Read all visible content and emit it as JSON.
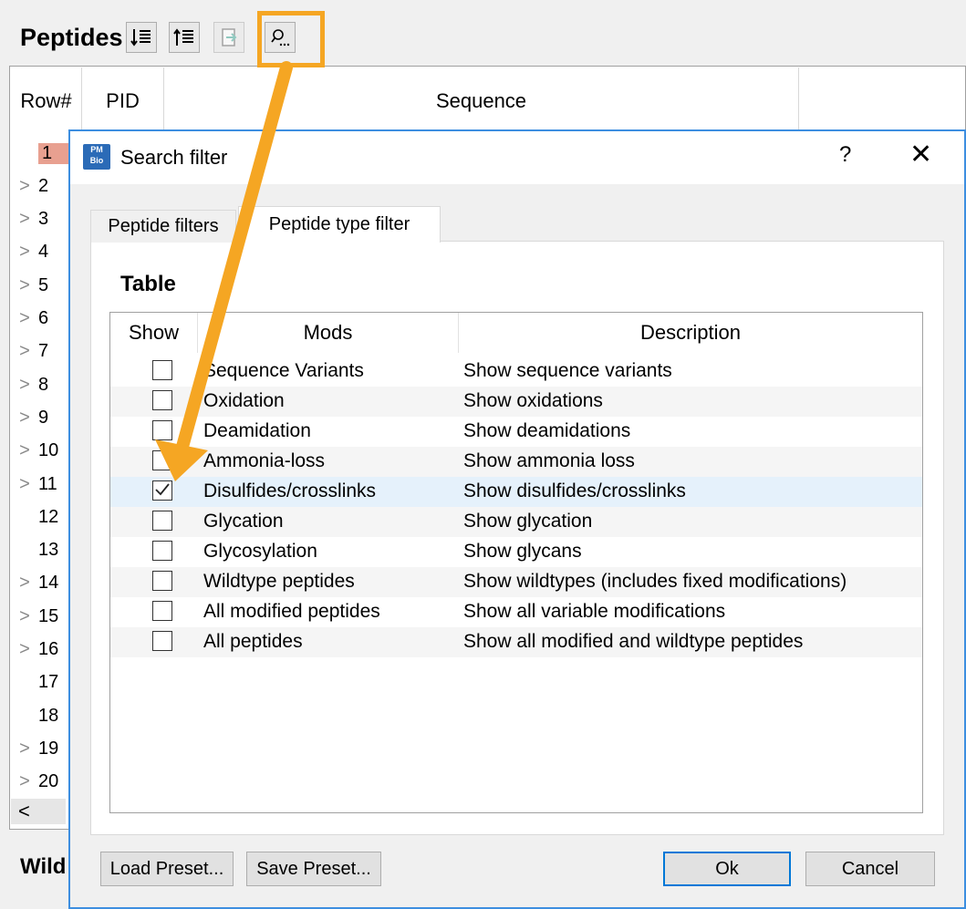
{
  "background": {
    "panel_title": "Peptides",
    "toolbar_icons": [
      "sort-descending-icon",
      "sort-ascending-icon",
      "export-icon",
      "search-filter-icon"
    ],
    "columns": [
      "Row#",
      "PID",
      "Sequence"
    ],
    "rows": [
      {
        "num": "1",
        "expandable": false,
        "highlight": true
      },
      {
        "num": "2",
        "expandable": true
      },
      {
        "num": "3",
        "expandable": true
      },
      {
        "num": "4",
        "expandable": true
      },
      {
        "num": "5",
        "expandable": true
      },
      {
        "num": "6",
        "expandable": true
      },
      {
        "num": "7",
        "expandable": true
      },
      {
        "num": "8",
        "expandable": true
      },
      {
        "num": "9",
        "expandable": true
      },
      {
        "num": "10",
        "expandable": true
      },
      {
        "num": "11",
        "expandable": true
      },
      {
        "num": "12",
        "expandable": false
      },
      {
        "num": "13",
        "expandable": false
      },
      {
        "num": "14",
        "expandable": true
      },
      {
        "num": "15",
        "expandable": true
      },
      {
        "num": "16",
        "expandable": true
      },
      {
        "num": "17",
        "expandable": false
      },
      {
        "num": "18",
        "expandable": false
      },
      {
        "num": "19",
        "expandable": true
      },
      {
        "num": "20",
        "expandable": true
      }
    ],
    "scroll_left": "<",
    "lower_panel_title": "Wild"
  },
  "dialog": {
    "title": "Search filter",
    "help": "?",
    "close": "✕",
    "tabs": [
      {
        "label": "Peptide filters",
        "active": false
      },
      {
        "label": "Peptide type filter",
        "active": true
      }
    ],
    "section_title": "Table",
    "table": {
      "headers": [
        "Show",
        "Mods",
        "Description"
      ],
      "rows": [
        {
          "checked": false,
          "mod": "Sequence Variants",
          "desc": "Show sequence variants"
        },
        {
          "checked": false,
          "mod": "Oxidation",
          "desc": "Show oxidations"
        },
        {
          "checked": false,
          "mod": "Deamidation",
          "desc": "Show deamidations"
        },
        {
          "checked": false,
          "mod": "Ammonia-loss",
          "desc": "Show ammonia loss"
        },
        {
          "checked": true,
          "mod": "Disulfides/crosslinks",
          "desc": "Show disulfides/crosslinks"
        },
        {
          "checked": false,
          "mod": "Glycation",
          "desc": "Show glycation"
        },
        {
          "checked": false,
          "mod": "Glycosylation",
          "desc": "Show glycans"
        },
        {
          "checked": false,
          "mod": "Wildtype peptides",
          "desc": "Show wildtypes (includes fixed modifications)"
        },
        {
          "checked": false,
          "mod": "All modified peptides",
          "desc": "Show all variable modifications"
        },
        {
          "checked": false,
          "mod": "All peptides",
          "desc": "Show all modified and wildtype peptides"
        }
      ]
    },
    "buttons": {
      "load_preset": "Load Preset...",
      "save_preset": "Save Preset...",
      "ok": "Ok",
      "cancel": "Cancel"
    }
  },
  "colors": {
    "annotation": "#f5a623",
    "accent": "#0078d7",
    "selected_row": "#e5f1fb",
    "row_highlight": "#e8a090"
  }
}
